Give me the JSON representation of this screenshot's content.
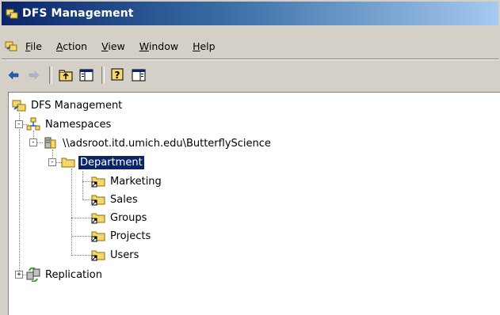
{
  "window": {
    "title": "DFS Management"
  },
  "menu": {
    "items": [
      {
        "accel": "F",
        "rest": "ile"
      },
      {
        "accel": "A",
        "rest": "ction"
      },
      {
        "accel": "V",
        "rest": "iew"
      },
      {
        "accel": "W",
        "rest": "indow"
      },
      {
        "accel": "H",
        "rest": "elp"
      }
    ]
  },
  "toolbar": {
    "icons": [
      "back-arrow-icon",
      "forward-arrow-icon",
      "up-folder-icon",
      "show-hide-console-tree-icon",
      "help-icon",
      "show-hide-action-pane-icon"
    ]
  },
  "tree": {
    "root": "DFS Management",
    "namespaces": "Namespaces",
    "namespace_path": "\\\\adsroot.itd.umich.edu\\ButterflyScience",
    "department": "Department",
    "marketing": "Marketing",
    "sales": "Sales",
    "groups": "Groups",
    "projects": "Projects",
    "users": "Users",
    "replication": "Replication",
    "expander_minus": "-",
    "expander_plus": "+"
  },
  "colors": {
    "title_start": "#0a246a",
    "title_end": "#a6caf0",
    "selection": "#0a246a",
    "chrome": "#d4d0c8"
  }
}
